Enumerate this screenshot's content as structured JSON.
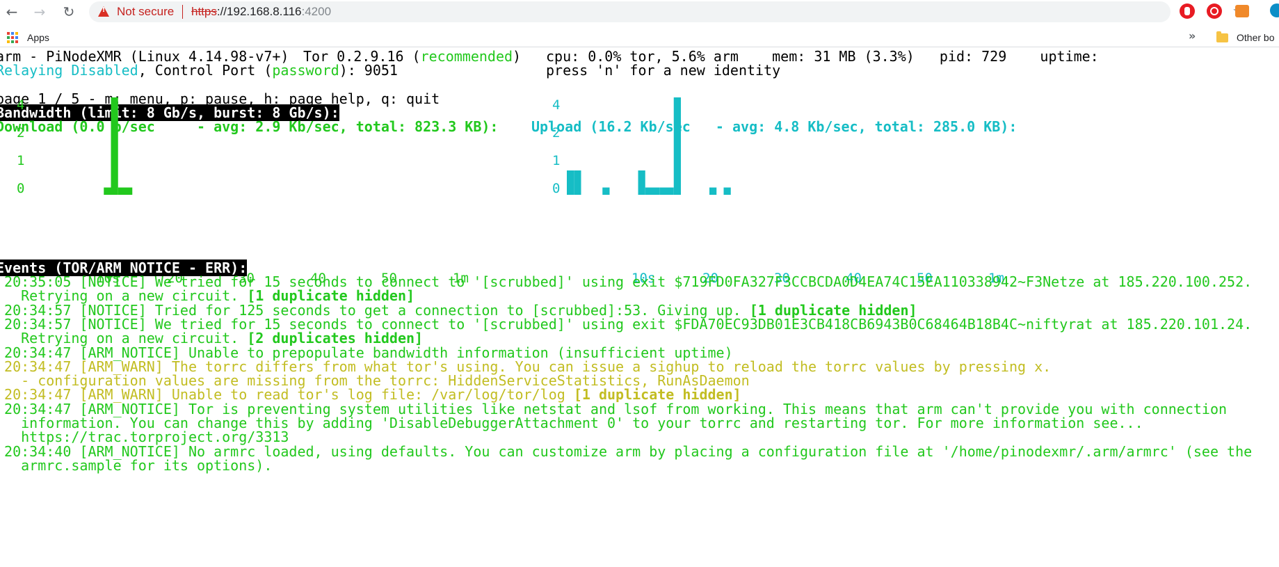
{
  "browser": {
    "security_text": "Not secure",
    "url_scheme": "https",
    "url_host": "://192.168.8.116",
    "url_port": ":4200",
    "bookmarks_apps": "Apps",
    "bookmarks_more": "»",
    "bookmarks_other": "Other bo"
  },
  "header": {
    "line1_app": "arm - PiNodeXMR (Linux 4.14.98-v7+)",
    "line1_tor": "Tor 0.2.9.16 (",
    "line1_tor_status": "recommended",
    "line1_tor_close": ")",
    "line1_stats": "cpu: 0.0% tor, 5.6% arm    mem: 31 MB (3.3%)   pid: 729    uptime:",
    "line2_relaying": "Relaying Disabled",
    "line2_control": ", Control Port (",
    "line2_password": "password",
    "line2_port": "): 9051",
    "line2_identity": "press 'n' for a new identity",
    "page_line": "page 1 / 5 - m: menu, p: pause, h: page help, q: quit"
  },
  "bandwidth": {
    "title": "Bandwidth (limit: 8 Gb/s, burst: 8 Gb/s):",
    "download_title": "Download (0.0 b/sec     - avg: 2.9 Kb/sec, total: 823.3 KB):",
    "upload_title": "Upload (16.2 Kb/sec   - avg: 4.8 Kb/sec, total: 285.0 KB):"
  },
  "chart_data": [
    {
      "type": "bar",
      "title": "Download (0.0 b/sec     - avg: 2.9 Kb/sec, total: 823.3 KB):",
      "y_tick_labels": [
        "4",
        "2",
        "1",
        "0"
      ],
      "x_tick_labels": [
        "10s",
        "20",
        "30",
        "40",
        "50",
        "1m"
      ],
      "x": [
        6,
        7,
        8,
        9
      ],
      "values": [
        0.3,
        4,
        0.3,
        0.3
      ],
      "color": "#22c81d"
    },
    {
      "type": "bar",
      "title": "Upload (16.2 Kb/sec   - avg: 4.8 Kb/sec, total: 285.0 KB):",
      "y_tick_labels": [
        "4",
        "2",
        "1",
        "0"
      ],
      "x_tick_labels": [
        "10s",
        "20",
        "30",
        "40",
        "50",
        "1m"
      ],
      "x": [
        1,
        2,
        6,
        11,
        12,
        13,
        14,
        15,
        16,
        21,
        23
      ],
      "values": [
        1.0,
        1.0,
        0.3,
        1.0,
        0.3,
        0.3,
        0.3,
        0.3,
        4,
        0.3,
        0.3
      ],
      "color": "#16bdc5"
    }
  ],
  "events": {
    "title": "Events (TOR/ARM NOTICE - ERR):",
    "lines": [
      {
        "text": " 20:35:05 [NOTICE] We tried for 15 seconds to connect to '[scrubbed]' using exit $719FD0FA327F3CCBCDA0D4EA74C15EA110338942~F3Netze at 185.220.100.252.",
        "bold": "",
        "color": "green"
      },
      {
        "text": "   Retrying on a new circuit. ",
        "bold": "[1 duplicate hidden]",
        "color": "green"
      },
      {
        "text": " 20:34:57 [NOTICE] Tried for 125 seconds to get a connection to [scrubbed]:53. Giving up. ",
        "bold": "[1 duplicate hidden]",
        "color": "green"
      },
      {
        "text": " 20:34:57 [NOTICE] We tried for 15 seconds to connect to '[scrubbed]' using exit $FDA70EC93DB01E3CB418CB6943B0C68464B18B4C~niftyrat at 185.220.101.24.",
        "bold": "",
        "color": "green"
      },
      {
        "text": "   Retrying on a new circuit. ",
        "bold": "[2 duplicates hidden]",
        "color": "green"
      },
      {
        "text": " 20:34:47 [ARM_NOTICE] Unable to prepopulate bandwidth information (insufficient uptime)",
        "bold": "",
        "color": "green"
      },
      {
        "text": " 20:34:47 [ARM_WARN] The torrc differs from what tor's using. You can issue a sighup to reload the torrc values by pressing x.",
        "bold": "",
        "color": "yellow"
      },
      {
        "text": "   - configuration values are missing from the torrc: HiddenServiceStatistics, RunAsDaemon",
        "bold": "",
        "color": "yellow"
      },
      {
        "text": " 20:34:47 [ARM_WARN] Unable to read tor's log file: /var/log/tor/log ",
        "bold": "[1 duplicate hidden]",
        "color": "yellow"
      },
      {
        "text": " 20:34:47 [ARM_NOTICE] Tor is preventing system utilities like netstat and lsof from working. This means that arm can't provide you with connection",
        "bold": "",
        "color": "green"
      },
      {
        "text": "   information. You can change this by adding 'DisableDebuggerAttachment 0' to your torrc and restarting tor. For more information see...",
        "bold": "",
        "color": "green"
      },
      {
        "text": "   https://trac.torproject.org/3313",
        "bold": "",
        "color": "green"
      },
      {
        "text": " 20:34:40 [ARM_NOTICE] No armrc loaded, using defaults. You can customize arm by placing a configuration file at '/home/pinodexmr/.arm/armrc' (see the",
        "bold": "",
        "color": "green"
      },
      {
        "text": "   armrc.sample for its options).",
        "bold": "",
        "color": "green"
      }
    ]
  }
}
